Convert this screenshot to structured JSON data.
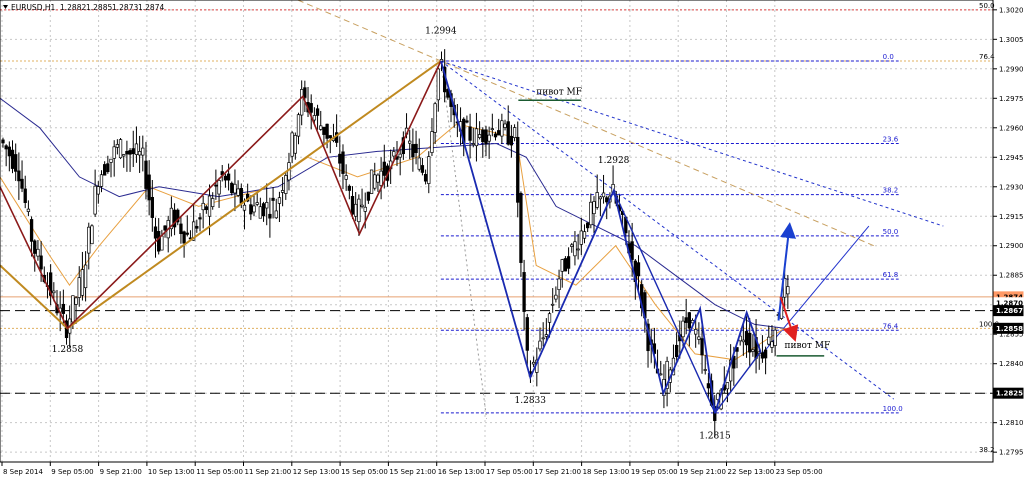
{
  "chart_data": {
    "type": "candlestick",
    "title": "EURUSD,H1",
    "ohlc_header": [
      "1.2882",
      "1.2885",
      "1.2873",
      "1.2874"
    ],
    "ylim": [
      1.279,
      1.3025
    ],
    "y_ticks": [
      "1.3020",
      "1.3005",
      "1.2990",
      "1.2975",
      "1.2960",
      "1.2945",
      "1.2930",
      "1.2915",
      "1.2900",
      "1.2885",
      "1.2870",
      "1.2855",
      "1.2840",
      "1.2825",
      "1.2810",
      "1.2795"
    ],
    "x_labels": [
      "8 Sep 2014",
      "9 Sep 05:00",
      "9 Sep 21:00",
      "10 Sep 13:00",
      "11 Sep 05:00",
      "11 Sep 21:00",
      "12 Sep 13:00",
      "15 Sep 05:00",
      "15 Sep 21:00",
      "16 Sep 13:00",
      "17 Sep 05:00",
      "17 Sep 21:00",
      "18 Sep 13:00",
      "19 Sep 05:00",
      "19 Sep 21:00",
      "22 Sep 13:00",
      "23 Sep 05:00"
    ],
    "price_path": [
      [
        0,
        1.2955
      ],
      [
        0.02,
        1.294
      ],
      [
        0.035,
        1.29
      ],
      [
        0.05,
        1.288
      ],
      [
        0.068,
        1.2858
      ],
      [
        0.085,
        1.2885
      ],
      [
        0.1,
        1.2935
      ],
      [
        0.12,
        1.295
      ],
      [
        0.145,
        1.2945
      ],
      [
        0.16,
        1.29
      ],
      [
        0.175,
        1.2915
      ],
      [
        0.19,
        1.2905
      ],
      [
        0.205,
        1.2915
      ],
      [
        0.225,
        1.2935
      ],
      [
        0.24,
        1.2925
      ],
      [
        0.255,
        1.292
      ],
      [
        0.28,
        1.292
      ],
      [
        0.295,
        1.295
      ],
      [
        0.305,
        1.2976
      ],
      [
        0.32,
        1.2965
      ],
      [
        0.34,
        1.295
      ],
      [
        0.36,
        1.2915
      ],
      [
        0.378,
        1.2935
      ],
      [
        0.395,
        1.294
      ],
      [
        0.41,
        1.2955
      ],
      [
        0.43,
        1.2935
      ],
      [
        0.444,
        1.2994
      ],
      [
        0.46,
        1.296
      ],
      [
        0.48,
        1.2955
      ],
      [
        0.5,
        1.296
      ],
      [
        0.52,
        1.2955
      ],
      [
        0.528,
        1.287
      ],
      [
        0.534,
        1.2833
      ],
      [
        0.55,
        1.2855
      ],
      [
        0.565,
        1.2885
      ],
      [
        0.58,
        1.29
      ],
      [
        0.6,
        1.292
      ],
      [
        0.618,
        1.2928
      ],
      [
        0.632,
        1.2905
      ],
      [
        0.645,
        1.288
      ],
      [
        0.655,
        1.285
      ],
      [
        0.668,
        1.2828
      ],
      [
        0.68,
        1.2845
      ],
      [
        0.695,
        1.2865
      ],
      [
        0.705,
        1.285
      ],
      [
        0.72,
        1.2815
      ],
      [
        0.735,
        1.2835
      ],
      [
        0.75,
        1.2855
      ],
      [
        0.765,
        1.2845
      ],
      [
        0.775,
        1.285
      ],
      [
        0.783,
        1.286
      ],
      [
        0.79,
        1.2882
      ],
      [
        0.795,
        1.2874
      ]
    ],
    "fibonacci": {
      "levels": [
        {
          "label": "0.0",
          "value": 1.2994
        },
        {
          "label": "23.6",
          "value": 1.2952
        },
        {
          "label": "38.2",
          "value": 1.2926
        },
        {
          "label": "50.0",
          "value": 1.2905
        },
        {
          "label": "61.8",
          "value": 1.2883
        },
        {
          "label": "76.4",
          "value": 1.2857
        },
        {
          "label": "100.0",
          "value": 1.2815
        }
      ]
    },
    "outer_fib_labels": [
      {
        "label": "50.0",
        "value": 1.302
      },
      {
        "label": "76.4",
        "value": 1.2994
      },
      {
        "label": "100.0",
        "value": 1.2858
      },
      {
        "label": "38.2",
        "value": 1.2794
      }
    ],
    "horizontal_lines": [
      {
        "value": 1.2874,
        "color": "#e8a070"
      },
      {
        "value": 1.2867,
        "color": "#000000"
      },
      {
        "value": 1.2825,
        "color": "#000000"
      },
      {
        "value": 1.2858,
        "color": "#e0b060"
      }
    ],
    "price_tags": [
      {
        "label": "1.2874",
        "bg": "#ff9966",
        "fg": "#000000",
        "value": 1.2874
      },
      {
        "label": "1.2870",
        "bg": "#ffffff",
        "fg": "#000000",
        "value": 1.2871
      },
      {
        "label": "1.2867",
        "bg": "#000000",
        "fg": "#ffffff",
        "value": 1.2867
      },
      {
        "label": "1.2858",
        "bg": "#000000",
        "fg": "#ffffff",
        "value": 1.2858
      },
      {
        "label": "1.2825",
        "bg": "#000000",
        "fg": "#ffffff",
        "value": 1.2825
      }
    ],
    "annotations": [
      {
        "text": "1.2994",
        "x": 0.444,
        "y": 1.3008
      },
      {
        "text": "1.2928",
        "x": 0.618,
        "y": 1.2942
      },
      {
        "text": "1.2858",
        "x": 0.068,
        "y": 1.2846
      },
      {
        "text": "1.2833",
        "x": 0.534,
        "y": 1.282
      },
      {
        "text": "1.2815",
        "x": 0.72,
        "y": 1.2802
      },
      {
        "text": "пивот MF",
        "x": 0.54,
        "y": 1.2977
      },
      {
        "text": "пивот MF",
        "x": 0.79,
        "y": 1.2848
      }
    ],
    "pivot_lines": [
      [
        [
          0.522,
          1.2974
        ],
        [
          0.585,
          1.2974
        ]
      ],
      [
        [
          0.782,
          1.2844
        ],
        [
          0.83,
          1.2844
        ]
      ]
    ],
    "zigzag_brown": [
      [
        0,
        1.293
      ],
      [
        0.068,
        1.2858
      ],
      [
        0.305,
        1.2976
      ],
      [
        0.362,
        1.2906
      ],
      [
        0.444,
        1.2994
      ]
    ],
    "zigzag_gold": [
      [
        0,
        1.289
      ],
      [
        0.068,
        1.2858
      ],
      [
        0.444,
        1.2994
      ]
    ],
    "zigzag_blue": [
      [
        0.444,
        1.2994
      ],
      [
        0.534,
        1.2833
      ],
      [
        0.618,
        1.2928
      ],
      [
        0.668,
        1.2825
      ],
      [
        0.705,
        1.2868
      ],
      [
        0.72,
        1.2815
      ],
      [
        0.752,
        1.2866
      ],
      [
        0.766,
        1.2846
      ]
    ],
    "zigzag_blue2": [
      [
        0.618,
        1.2928
      ],
      [
        0.72,
        1.2815
      ],
      [
        0.766,
        1.2846
      ]
    ],
    "trend_lines": [
      {
        "points": [
          [
            0.3,
            1.3025
          ],
          [
            0.88,
            1.29
          ]
        ],
        "color": "#c8a060",
        "dash": "6 4"
      },
      {
        "points": [
          [
            0.444,
            1.2994
          ],
          [
            0.95,
            1.291
          ]
        ],
        "color": "#2233cc",
        "dash": "3 3"
      },
      {
        "points": [
          [
            0.444,
            1.2994
          ],
          [
            0.9,
            1.2822
          ]
        ],
        "color": "#2233cc",
        "dash": "3 3"
      },
      {
        "points": [
          [
            0.766,
            1.2844
          ],
          [
            0.875,
            1.291
          ]
        ],
        "color": "#2233cc",
        "dash": ""
      },
      {
        "points": [
          [
            0.444,
            1.2994
          ],
          [
            0.49,
            1.2812
          ]
        ],
        "color": "#999999",
        "dash": "2 3"
      }
    ],
    "ma_fast": [
      [
        0,
        1.2935
      ],
      [
        0.05,
        1.2895
      ],
      [
        0.07,
        1.288
      ],
      [
        0.1,
        1.29
      ],
      [
        0.15,
        1.293
      ],
      [
        0.2,
        1.292
      ],
      [
        0.26,
        1.2928
      ],
      [
        0.31,
        1.2945
      ],
      [
        0.36,
        1.2935
      ],
      [
        0.42,
        1.2945
      ],
      [
        0.46,
        1.2962
      ],
      [
        0.52,
        1.2955
      ],
      [
        0.54,
        1.289
      ],
      [
        0.58,
        1.288
      ],
      [
        0.62,
        1.29
      ],
      [
        0.66,
        1.287
      ],
      [
        0.7,
        1.2845
      ],
      [
        0.74,
        1.2842
      ],
      [
        0.79,
        1.2858
      ]
    ],
    "ma_slow": [
      [
        0,
        1.2975
      ],
      [
        0.04,
        1.296
      ],
      [
        0.08,
        1.2935
      ],
      [
        0.12,
        1.2925
      ],
      [
        0.16,
        1.293
      ],
      [
        0.22,
        1.2925
      ],
      [
        0.28,
        1.293
      ],
      [
        0.33,
        1.2945
      ],
      [
        0.38,
        1.2948
      ],
      [
        0.44,
        1.295
      ],
      [
        0.5,
        1.2952
      ],
      [
        0.53,
        1.2945
      ],
      [
        0.56,
        1.292
      ],
      [
        0.6,
        1.291
      ],
      [
        0.64,
        1.29
      ],
      [
        0.68,
        1.2885
      ],
      [
        0.72,
        1.287
      ],
      [
        0.76,
        1.286
      ],
      [
        0.79,
        1.2858
      ]
    ],
    "arrows": [
      {
        "from": [
          0.784,
          1.2862
        ],
        "to": [
          0.795,
          1.291
        ],
        "color": "#1a40d0"
      },
      {
        "from": [
          0.786,
          1.2874
        ],
        "to": [
          0.8,
          1.2853
        ],
        "color": "#e02020"
      }
    ],
    "grid": true
  }
}
